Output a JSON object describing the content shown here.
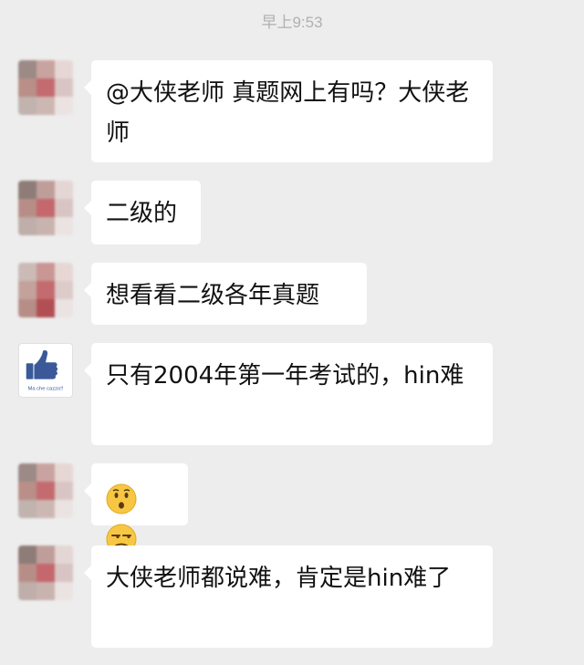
{
  "header": {
    "time": "早上9:53"
  },
  "messages": [
    {
      "text": "@大侠老师  真题网上有吗？大侠老师"
    },
    {
      "text": "二级的"
    },
    {
      "text": "想看看二级各年真题"
    },
    {
      "text": "只有2004年第一年考试的，hin难"
    },
    {
      "emojis": [
        "hushed-face-icon",
        "unamused-face-icon"
      ]
    },
    {
      "text": "大侠老师都说难，肯定是hin难了"
    }
  ],
  "avatars": {
    "logo_caption": "Ma che cazzo!!"
  },
  "colors": {
    "background": "#ededed",
    "bubble": "#ffffff",
    "timestamp": "#b0b0b0"
  }
}
